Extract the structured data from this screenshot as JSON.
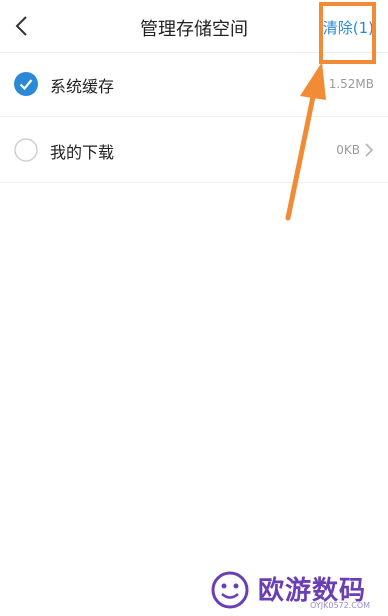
{
  "header": {
    "title": "管理存储空间",
    "clear_label": "清除(1)"
  },
  "rows": [
    {
      "label": "系统缓存",
      "value": "1.52MB",
      "checked": true
    },
    {
      "label": "我的下载",
      "value": "0KB",
      "checked": false
    }
  ],
  "watermark": {
    "text": "欧游数码",
    "url": "OYJK0572.COM"
  },
  "colors": {
    "accent": "#2b8ad6",
    "highlight": "#f28b35"
  }
}
